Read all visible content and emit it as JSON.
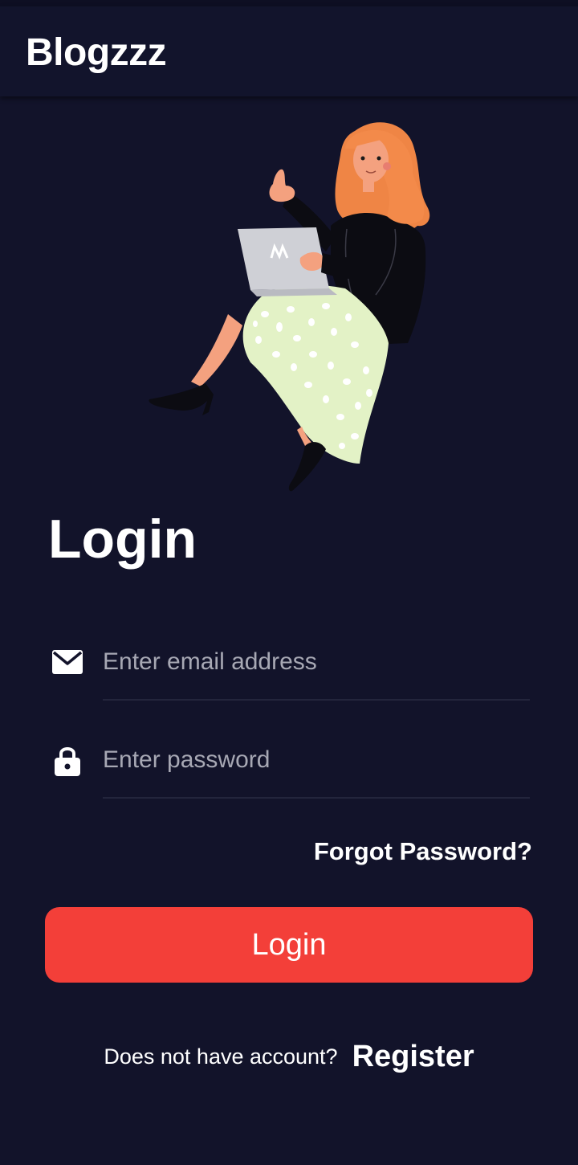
{
  "app_bar": {
    "title": "Blogzzz"
  },
  "illustration": {
    "icon": "woman-with-laptop-illustration"
  },
  "form": {
    "heading": "Login",
    "email": {
      "placeholder": "Enter email address",
      "value": "",
      "icon": "email-icon"
    },
    "password": {
      "placeholder": "Enter password",
      "value": "",
      "icon": "lock-icon"
    },
    "forgot_label": "Forgot Password?",
    "submit_label": "Login"
  },
  "footer": {
    "prompt": "Does not have account?",
    "register_label": "Register"
  },
  "colors": {
    "background": "#12132a",
    "app_bar": "#12142c",
    "accent": "#f33f39",
    "placeholder": "#a7a8b4"
  }
}
